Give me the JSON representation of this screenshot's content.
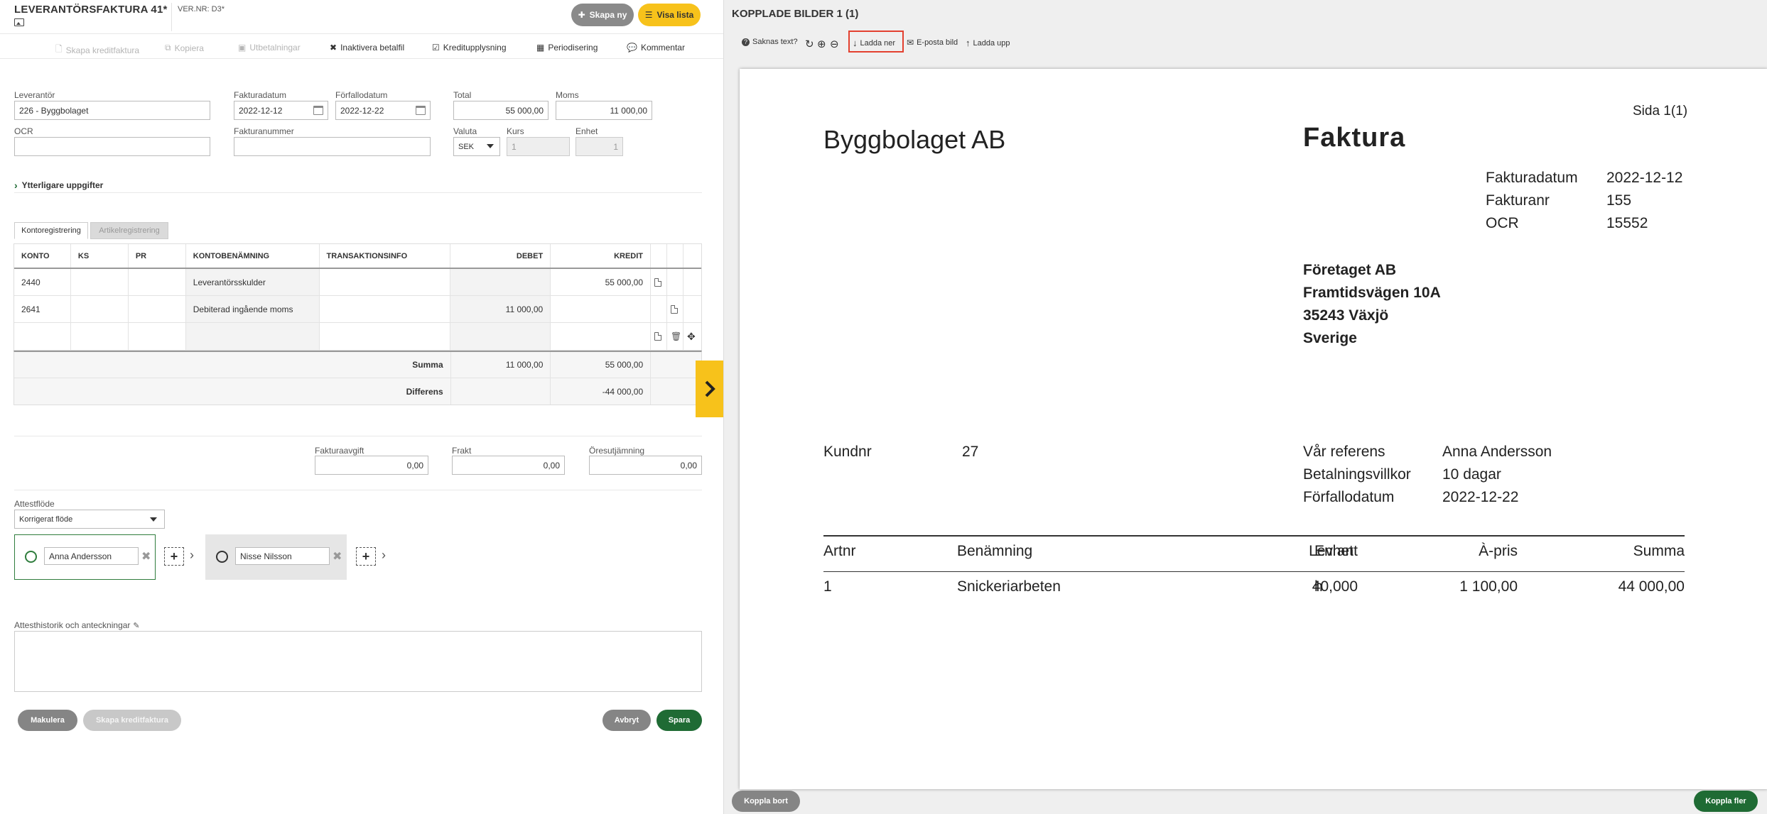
{
  "colors": {
    "accent_yellow": "#f7c21b",
    "primary_green": "#1f6b34",
    "download_highlight": "#e3402f"
  },
  "header": {
    "title": "LEVERANTÖRSFAKTURA 41*",
    "vernr": "VER.NR: D3*",
    "image_icon": "image-icon",
    "create_new": "Skapa ny",
    "show_list": "Visa lista"
  },
  "toolbar": {
    "create_credit": "Skapa kreditfaktura",
    "copy": "Kopiera",
    "payments": "Utbetalningar",
    "inactivate": "Inaktivera betalfil",
    "credit_info": "Kreditupplysning",
    "periodize": "Periodisering",
    "comment": "Kommentar"
  },
  "form": {
    "supplier_label": "Leverantör",
    "supplier_value": "226 - Byggbolaget",
    "invoice_date_label": "Fakturadatum",
    "invoice_date_value": "2022-12-12",
    "due_date_label": "Förfallodatum",
    "due_date_value": "2022-12-22",
    "total_label": "Total",
    "total_value": "55 000,00",
    "vat_label": "Moms",
    "vat_value": "11 000,00",
    "ocr_label": "OCR",
    "ocr_value": "",
    "invoice_no_label": "Fakturanummer",
    "invoice_no_value": "",
    "currency_label": "Valuta",
    "currency_value": "SEK",
    "rate_label": "Kurs",
    "rate_value": "1",
    "unit_label": "Enhet",
    "unit_value": "1",
    "more_details": "Ytterligare uppgifter"
  },
  "tabs": {
    "account": "Kontoregistrering",
    "article": "Artikelregistrering"
  },
  "grid": {
    "headers": {
      "konto": "KONTO",
      "ks": "KS",
      "pr": "PR",
      "name": "KONTOBENÄMNING",
      "info": "TRANSAKTIONSINFO",
      "debit": "DEBET",
      "credit": "KREDIT"
    },
    "rows": [
      {
        "konto": "2440",
        "ks": "",
        "pr": "",
        "name": "Leverantörsskulder",
        "info": "",
        "debit": "",
        "credit": "55 000,00"
      },
      {
        "konto": "2641",
        "ks": "",
        "pr": "",
        "name": "Debiterad ingående moms",
        "info": "",
        "debit": "11 000,00",
        "credit": ""
      }
    ],
    "sum_label": "Summa",
    "sum_debit": "11 000,00",
    "sum_credit": "55 000,00",
    "diff_label": "Differens",
    "diff_debit": "",
    "diff_credit": "-44 000,00"
  },
  "fees": {
    "invoice_fee_label": "Fakturaavgift",
    "invoice_fee_value": "0,00",
    "freight_label": "Frakt",
    "freight_value": "0,00",
    "rounding_label": "Öresutjämning",
    "rounding_value": "0,00"
  },
  "attest": {
    "flow_label": "Attestflöde",
    "flow_value": "Korrigerat flöde",
    "person1": "Anna Andersson",
    "person2": "Nisse Nilsson",
    "history_label": "Attesthistorik och anteckningar",
    "history_value": ""
  },
  "footer": {
    "discard": "Makulera",
    "create_credit": "Skapa kreditfaktura",
    "cancel": "Avbryt",
    "save": "Spara"
  },
  "right": {
    "title": "KOPPLADE BILDER 1 (1)",
    "missing_text": "Saknas text?",
    "download": "Ladda ner",
    "email_image": "E-posta bild",
    "upload": "Ladda upp",
    "unlink": "Koppla bort",
    "link_more": "Koppla fler"
  },
  "invoice": {
    "page": "Sida 1(1)",
    "company": "Byggbolaget AB",
    "doc_title": "Faktura",
    "date_label": "Fakturadatum",
    "date_value": "2022-12-12",
    "no_label": "Fakturanr",
    "no_value": "155",
    "ocr_label": "OCR",
    "ocr_value": "15552",
    "recipient_name": "Företaget AB",
    "recipient_street": "Framtidsvägen 10A",
    "recipient_city": "35243 Växjö",
    "recipient_country": "Sverige",
    "customer_no_label": "Kundnr",
    "customer_no_value": "27",
    "ref_label": "Vår referens",
    "ref_value": "Anna Andersson",
    "terms_label": "Betalningsvillkor",
    "terms_value": "10 dagar",
    "due_label": "Förfallodatum",
    "due_value": "2022-12-22",
    "col_artnr": "Artnr",
    "col_name": "Benämning",
    "col_qty": "Lev ant",
    "col_unit": "Enhet",
    "col_price": "À-pris",
    "col_sum": "Summa",
    "line_artnr": "1",
    "line_name": "Snickeriarbeten",
    "line_qty": "40,000",
    "line_unit": "h",
    "line_price": "1 100,00",
    "line_sum": "44 000,00"
  }
}
